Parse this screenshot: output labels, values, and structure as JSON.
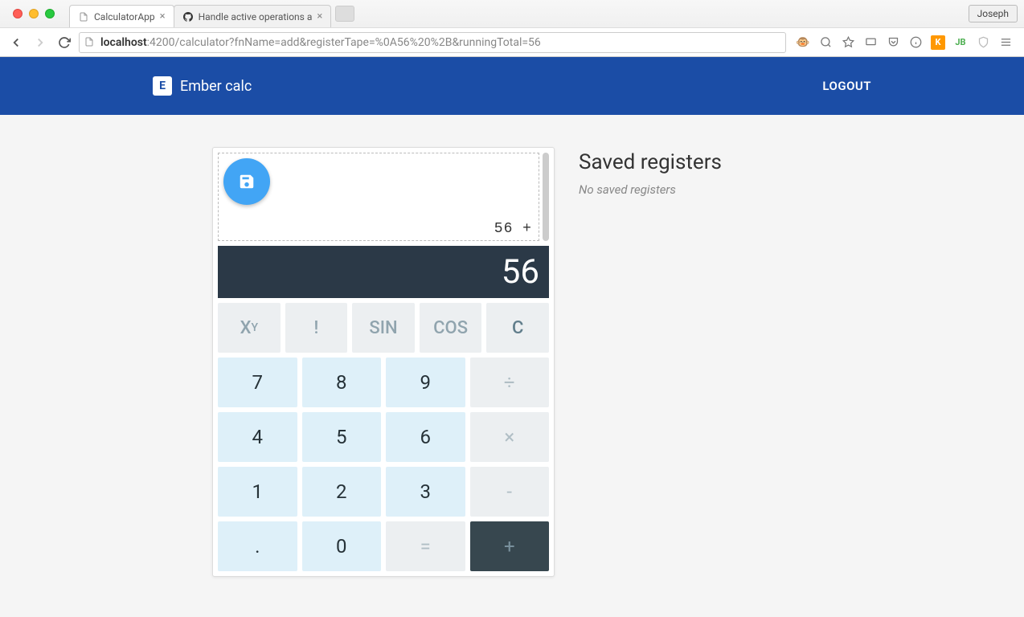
{
  "browser": {
    "tabs": [
      {
        "title": "CalculatorApp",
        "favicon": "page"
      },
      {
        "title": "Handle active operations a",
        "favicon": "github"
      }
    ],
    "profile": "Joseph",
    "url_host": "localhost",
    "url_rest": ":4200/calculator?fnName=add&registerTape=%0A56%20%2B&runningTotal=56"
  },
  "header": {
    "logo_letter": "E",
    "title": "Ember calc",
    "logout": "LOGOUT"
  },
  "calc": {
    "tape_text": "56 +",
    "display": "56",
    "func_buttons": [
      "Xʸ",
      "!",
      "SIN",
      "COS",
      "C"
    ],
    "rows": [
      [
        "7",
        "8",
        "9",
        "÷"
      ],
      [
        "4",
        "5",
        "6",
        "×"
      ],
      [
        "1",
        "2",
        "3",
        "-"
      ],
      [
        ".",
        "0",
        "=",
        "+"
      ]
    ],
    "active_op": "+"
  },
  "sidebar": {
    "title": "Saved registers",
    "empty_text": "No saved registers"
  }
}
